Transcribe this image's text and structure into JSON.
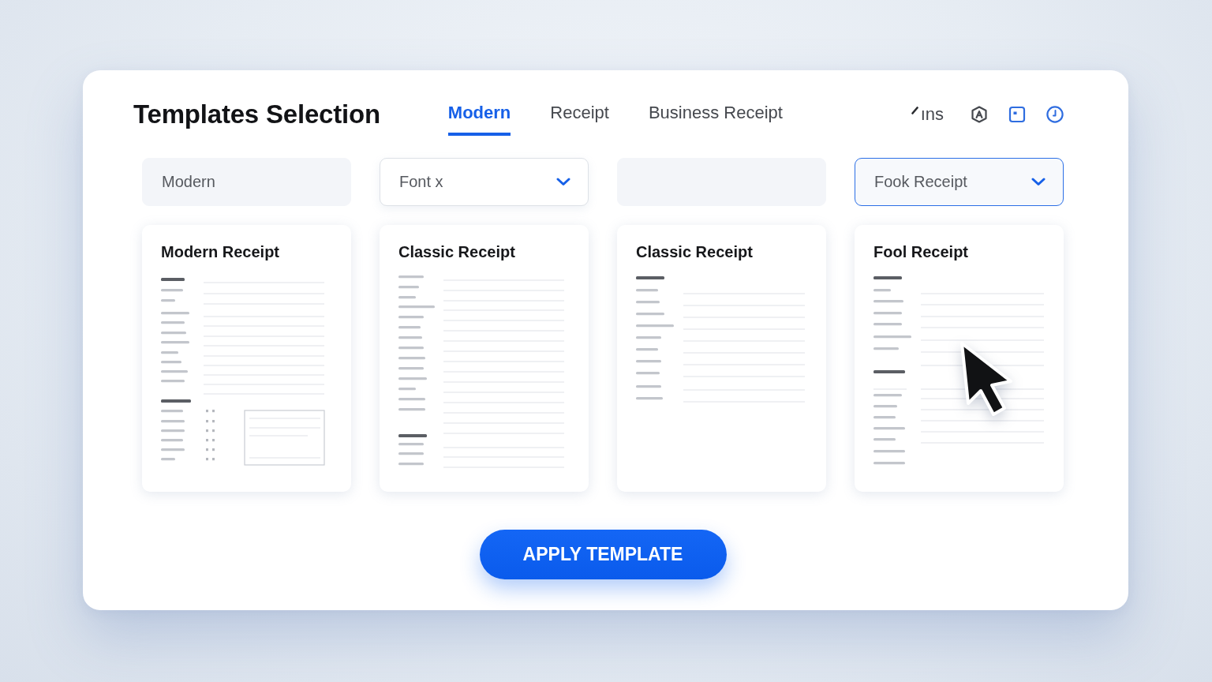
{
  "header": {
    "title": "Templates Selection"
  },
  "tabs": [
    {
      "label": "Modern",
      "selected": true
    },
    {
      "label": "Receipt",
      "selected": false
    },
    {
      "label": "Business Receipt",
      "selected": false
    }
  ],
  "toolbar": {
    "label": "ıns"
  },
  "fields": [
    {
      "kind": "input",
      "value": "Modern",
      "focused": false
    },
    {
      "kind": "select",
      "value": "Font x",
      "focused": false
    },
    {
      "kind": "input",
      "focused": false
    },
    {
      "kind": "select",
      "value": "Fook Receipt",
      "focused": true
    }
  ],
  "templates": [
    {
      "title": "Modern Receipt"
    },
    {
      "title": "Classic Receipt"
    },
    {
      "title": "Classic Receipt"
    },
    {
      "title": "Fool Receipt"
    }
  ],
  "apply_button": {
    "label": "APPLY TEMPLATE"
  }
}
